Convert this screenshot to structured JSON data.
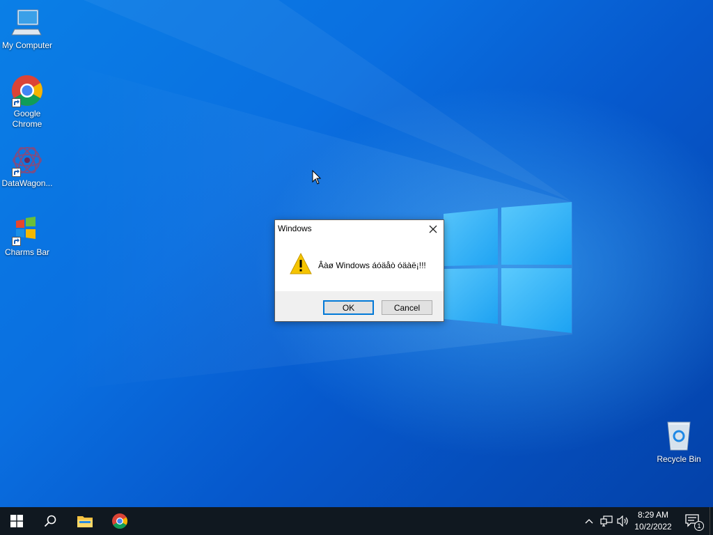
{
  "desktop": {
    "icons": [
      {
        "label": "My Computer"
      },
      {
        "label": "Google\nChrome"
      },
      {
        "label": "DataWagon..."
      },
      {
        "label": "Charms Bar"
      },
      {
        "label": "Recycle Bin"
      }
    ]
  },
  "dialog": {
    "title": "Windows",
    "message": "Âàø Windows áóäåò óäàë¡!!!",
    "ok_label": "OK",
    "cancel_label": "Cancel",
    "icon": "warning-icon"
  },
  "taskbar": {
    "items": [
      "start-icon",
      "search-icon",
      "file-explorer-icon",
      "chrome-icon"
    ],
    "tray": {
      "time": "8:29 AM",
      "date": "10/2/2022",
      "notification_count": "1"
    }
  },
  "colors": {
    "accent": "#0078d7",
    "taskbar": "#101820",
    "warning": "#f5c400"
  }
}
